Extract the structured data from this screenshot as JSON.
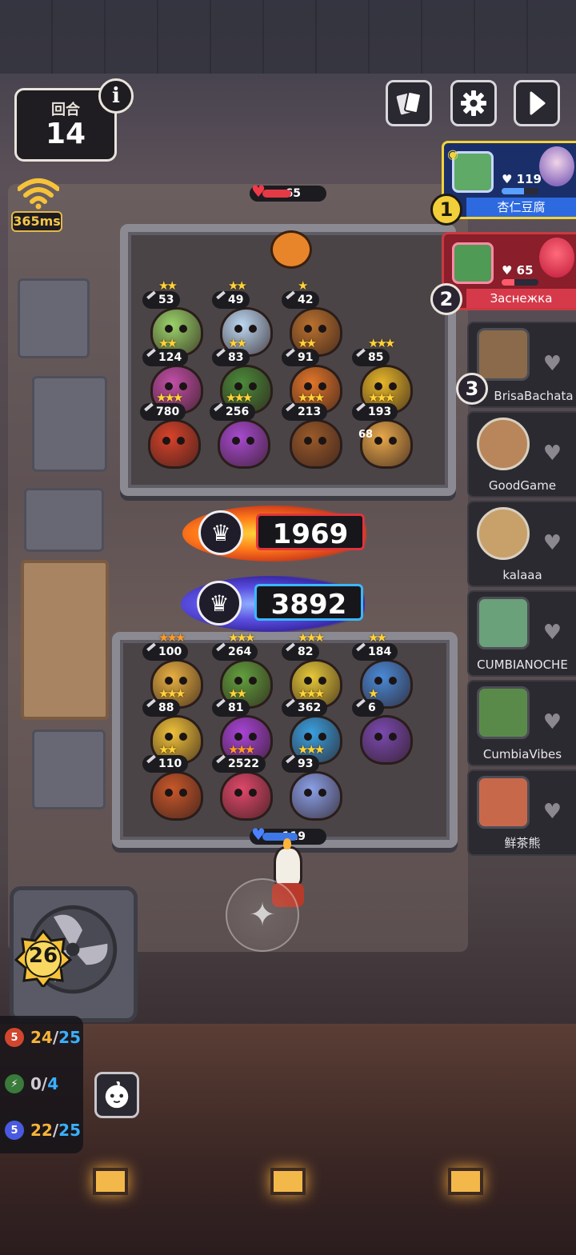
{
  "hud": {
    "round_label": "回合",
    "round_number": "14",
    "info_icon": "i",
    "ping": "365ms"
  },
  "top_buttons": [
    {
      "name": "cards-button",
      "icon": "cards-icon"
    },
    {
      "name": "settings-button",
      "icon": "gear-icon"
    },
    {
      "name": "next-button",
      "icon": "play-arrow-icon"
    }
  ],
  "players": {
    "top": [
      {
        "rank": "1",
        "name": "杏仁豆腐",
        "hp": "119",
        "hp_fraction": 0.6,
        "color": "#2d6ae0"
      },
      {
        "rank": "2",
        "name": "Заснежка",
        "hp": "65",
        "hp_fraction": 0.35,
        "color": "#d63a4a"
      }
    ],
    "others": [
      {
        "rank": "3",
        "name": "BrisaBachata"
      },
      {
        "rank": "",
        "name": "GoodGame"
      },
      {
        "rank": "",
        "name": "kalaaa"
      },
      {
        "rank": "",
        "name": "CUMBIANOCHE"
      },
      {
        "rank": "",
        "name": "CumbiaVibes"
      },
      {
        "rank": "",
        "name": "鲜茶熊"
      }
    ]
  },
  "board": {
    "enemy_hp": "65",
    "my_hp": "119",
    "enemy_power": "1969",
    "my_power": "3892",
    "enemy_units": [
      {
        "atk": "53",
        "stars": "★★",
        "color": "#9ad36a"
      },
      {
        "atk": "49",
        "stars": "★★",
        "color": "#bcd8f2"
      },
      {
        "atk": "42",
        "stars": "★",
        "color": "#b9712e"
      },
      {
        "atk": "124",
        "stars": "★★",
        "color": "#c24fa8"
      },
      {
        "atk": "83",
        "stars": "★★",
        "color": "#4b8a3a"
      },
      {
        "atk": "91",
        "stars": "★★",
        "color": "#e2762a"
      },
      {
        "atk": "85",
        "stars": "★★★",
        "color": "#e6b62a"
      },
      {
        "atk": "780",
        "stars": "★★★",
        "color": "#d8432a"
      },
      {
        "atk": "256",
        "stars": "★★★",
        "color": "#a84ad0"
      },
      {
        "atk": "213",
        "stars": "★★★",
        "color": "#9a5a2a"
      },
      {
        "atk": "193",
        "stars": "★★★",
        "color": "#e8a84a"
      }
    ],
    "enemy_extra_label": "68",
    "my_units": [
      {
        "atk": "100",
        "stars": "★★★",
        "orange": true,
        "color": "#e8b042"
      },
      {
        "atk": "264",
        "stars": "★★★",
        "orange": false,
        "color": "#62a03e"
      },
      {
        "atk": "82",
        "stars": "★★★",
        "orange": false,
        "color": "#e6c93a"
      },
      {
        "atk": "184",
        "stars": "★★",
        "orange": false,
        "color": "#4a8ad8"
      },
      {
        "atk": "88",
        "stars": "★★★",
        "orange": false,
        "color": "#f0c23a"
      },
      {
        "atk": "81",
        "stars": "★★",
        "orange": false,
        "color": "#a844d8"
      },
      {
        "atk": "362",
        "stars": "★★★",
        "orange": false,
        "color": "#3aa0e0"
      },
      {
        "atk": "6",
        "stars": "★",
        "orange": false,
        "color": "#7a4ab0"
      },
      {
        "atk": "110",
        "stars": "★★",
        "orange": false,
        "color": "#c8582a"
      },
      {
        "atk": "2522",
        "stars": "★★★",
        "orange": true,
        "color": "#e0486a"
      },
      {
        "atk": "93",
        "stars": "★★★",
        "orange": false,
        "color": "#8aa0e8"
      }
    ]
  },
  "player_level": "26",
  "resources": [
    {
      "level": "5",
      "current": "24",
      "max": "25",
      "current_color": "#f5b43a",
      "icon": "swords-icon",
      "icon_color": "#d2452e"
    },
    {
      "level": "",
      "current": "0",
      "max": "4",
      "current_color": "#cfcad4",
      "icon": "lightning-icon",
      "icon_color": "#3a7a3a"
    },
    {
      "level": "5",
      "current": "22",
      "max": "25",
      "current_color": "#f5b43a",
      "icon": "gem-icon",
      "icon_color": "#4a5ae0"
    }
  ],
  "colors": {
    "accent_gold": "#f2cf3a",
    "enemy_red": "#e0343c",
    "ally_blue": "#3ab8ff"
  }
}
